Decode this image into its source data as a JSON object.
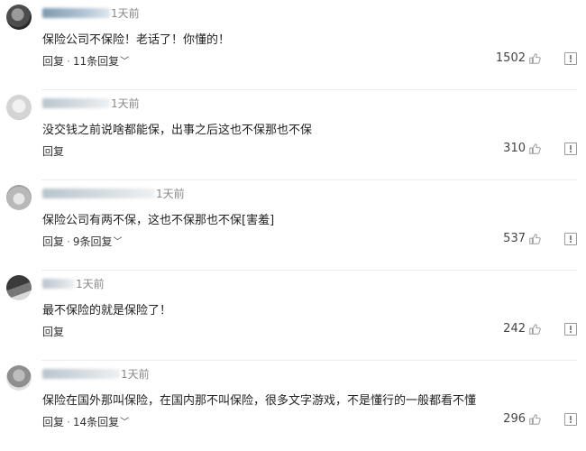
{
  "comments": [
    {
      "time": "1天前",
      "text": "保险公司不保险！老话了！你懂的！",
      "reply_label": "回复",
      "more_replies": "11条回复",
      "likes": "1502"
    },
    {
      "time": "1天前",
      "text": "没交钱之前说啥都能保，出事之后这也不保那也不保",
      "reply_label": "回复",
      "likes": "310"
    },
    {
      "time": "1天前",
      "text": "保险公司有两不保，这也不保那也不保[害羞]",
      "reply_label": "回复",
      "more_replies": "9条回复",
      "likes": "537"
    },
    {
      "time": "1天前",
      "text": "最不保险的就是保险了！",
      "reply_label": "回复",
      "likes": "242"
    },
    {
      "time": "1天前",
      "text": "保险在国外那叫保险，在国内那不叫保险，很多文字游戏，不是懂行的一般都看不懂",
      "reply_label": "回复",
      "more_replies": "14条回复",
      "likes": "296"
    }
  ]
}
